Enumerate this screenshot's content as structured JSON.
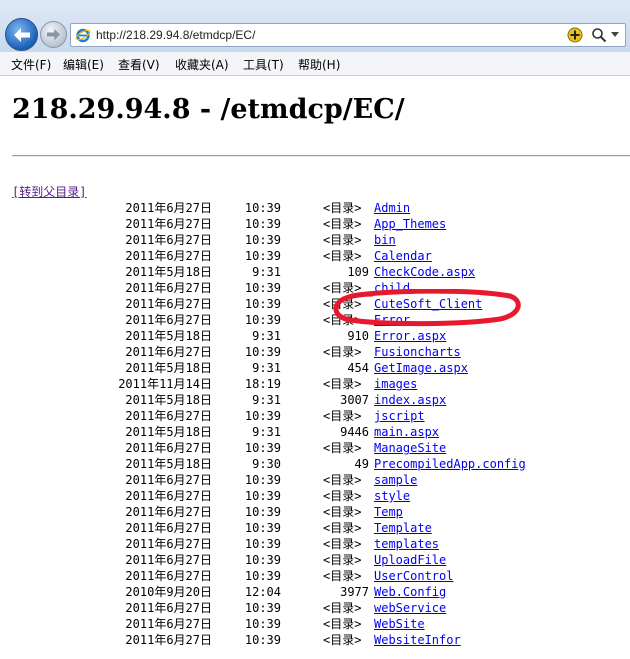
{
  "browser": {
    "address": "http://218.29.94.8/etmdcp/EC/",
    "menu": [
      "文件(F)",
      "编辑(E)",
      "查看(V)",
      "收藏夹(A)",
      "工具(T)",
      "帮助(H)"
    ]
  },
  "page": {
    "title": "218.29.94.8 - /etmdcp/EC/",
    "parent_link": "[转到父目录]",
    "entries": [
      {
        "date": "2011年6月27日",
        "time": "10:39",
        "kind": "<目录>",
        "size": "",
        "name": "Admin"
      },
      {
        "date": "2011年6月27日",
        "time": "10:39",
        "kind": "<目录>",
        "size": "",
        "name": "App_Themes"
      },
      {
        "date": "2011年6月27日",
        "time": "10:39",
        "kind": "<目录>",
        "size": "",
        "name": "bin"
      },
      {
        "date": "2011年6月27日",
        "time": "10:39",
        "kind": "<目录>",
        "size": "",
        "name": "Calendar"
      },
      {
        "date": "2011年5月18日",
        "time": "9:31",
        "kind": "",
        "size": "109",
        "name": "CheckCode.aspx"
      },
      {
        "date": "2011年6月27日",
        "time": "10:39",
        "kind": "<目录>",
        "size": "",
        "name": "child"
      },
      {
        "date": "2011年6月27日",
        "time": "10:39",
        "kind": "<目录>",
        "size": "",
        "name": "CuteSoft_Client"
      },
      {
        "date": "2011年6月27日",
        "time": "10:39",
        "kind": "<目录>",
        "size": "",
        "name": "Error"
      },
      {
        "date": "2011年5月18日",
        "time": "9:31",
        "kind": "",
        "size": "910",
        "name": "Error.aspx"
      },
      {
        "date": "2011年6月27日",
        "time": "10:39",
        "kind": "<目录>",
        "size": "",
        "name": "Fusioncharts"
      },
      {
        "date": "2011年5月18日",
        "time": "9:31",
        "kind": "",
        "size": "454",
        "name": "GetImage.aspx"
      },
      {
        "date": "2011年11月14日",
        "time": "18:19",
        "kind": "<目录>",
        "size": "",
        "name": "images"
      },
      {
        "date": "2011年5月18日",
        "time": "9:31",
        "kind": "",
        "size": "3007",
        "name": "index.aspx"
      },
      {
        "date": "2011年6月27日",
        "time": "10:39",
        "kind": "<目录>",
        "size": "",
        "name": "jscript"
      },
      {
        "date": "2011年5月18日",
        "time": "9:31",
        "kind": "",
        "size": "9446",
        "name": "main.aspx"
      },
      {
        "date": "2011年6月27日",
        "time": "10:39",
        "kind": "<目录>",
        "size": "",
        "name": "ManageSite"
      },
      {
        "date": "2011年5月18日",
        "time": "9:30",
        "kind": "",
        "size": "49",
        "name": "PrecompiledApp.config"
      },
      {
        "date": "2011年6月27日",
        "time": "10:39",
        "kind": "<目录>",
        "size": "",
        "name": "sample"
      },
      {
        "date": "2011年6月27日",
        "time": "10:39",
        "kind": "<目录>",
        "size": "",
        "name": "style"
      },
      {
        "date": "2011年6月27日",
        "time": "10:39",
        "kind": "<目录>",
        "size": "",
        "name": "Temp"
      },
      {
        "date": "2011年6月27日",
        "time": "10:39",
        "kind": "<目录>",
        "size": "",
        "name": "Template"
      },
      {
        "date": "2011年6月27日",
        "time": "10:39",
        "kind": "<目录>",
        "size": "",
        "name": "templates"
      },
      {
        "date": "2011年6月27日",
        "time": "10:39",
        "kind": "<目录>",
        "size": "",
        "name": "UploadFile"
      },
      {
        "date": "2011年6月27日",
        "time": "10:39",
        "kind": "<目录>",
        "size": "",
        "name": "UserControl"
      },
      {
        "date": "2010年9月20日",
        "time": "12:04",
        "kind": "",
        "size": "3977",
        "name": "Web.Config"
      },
      {
        "date": "2011年6月27日",
        "time": "10:39",
        "kind": "<目录>",
        "size": "",
        "name": "webService"
      },
      {
        "date": "2011年6月27日",
        "time": "10:39",
        "kind": "<目录>",
        "size": "",
        "name": "WebSite"
      },
      {
        "date": "2011年6月27日",
        "time": "10:39",
        "kind": "<目录>",
        "size": "",
        "name": "WebsiteInfor"
      }
    ]
  },
  "icons": {
    "back": "back-arrow-icon",
    "forward": "forward-arrow-icon",
    "page": "ie-logo-icon",
    "compat": "compatibility-view-icon",
    "search": "search-icon",
    "dropdown": "chevron-down-icon"
  },
  "colors": {
    "link": "#0000ee",
    "visited_link": "#551a8b",
    "annotation": "#e8192c"
  }
}
